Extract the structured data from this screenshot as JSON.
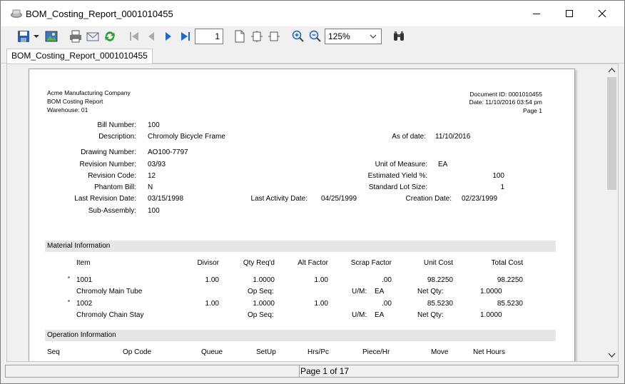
{
  "window": {
    "title": "BOM_Costing_Report_0001010455"
  },
  "toolbar": {
    "page_value": "1",
    "zoom_value": "125%"
  },
  "tabs": [
    {
      "label": "BOM_Costing_Report_0001010455"
    }
  ],
  "report": {
    "company": "Acme Manufacturing Company",
    "report_name": "BOM Costing Report",
    "warehouse": "Warehouse: 01",
    "document_id": "Document ID: 0001010455",
    "date": "Date: 11/10/2016 03:54 pm",
    "page": "Page 1",
    "labels": {
      "bill_number": "Bill Number:",
      "description": "Description:",
      "as_of_date": "As of date:",
      "drawing_number": "Drawing Number:",
      "revision_number": "Revision Number:",
      "revision_code": "Revision Code:",
      "phantom_bill": "Phantom Bill:",
      "last_revision_date": "Last Revision Date:",
      "sub_assembly": "Sub-Assembly:",
      "unit_of_measure": "Unit of Measure:",
      "estimated_yield": "Estimated Yield %:",
      "standard_lot_size": "Standard Lot Size:",
      "last_activity_date": "Last Activity Date:",
      "creation_date": "Creation Date:"
    },
    "values": {
      "bill_number": "100",
      "description": "Chromoly Bicycle Frame",
      "as_of_date": "11/10/2016",
      "drawing_number": "AO100-7797",
      "revision_number": "03/93",
      "revision_code": "12",
      "phantom_bill": "N",
      "last_revision_date": "03/15/1998",
      "sub_assembly": "100",
      "unit_of_measure": "EA",
      "estimated_yield": "100",
      "standard_lot_size": "1",
      "last_activity_date": "04/25/1999",
      "creation_date": "02/23/1999"
    },
    "material_section": "Material Information",
    "material_headers": {
      "item": "Item",
      "divisor": "Divisor",
      "qty_reqd": "Qty Req'd",
      "alt_factor": "Alt Factor",
      "scrap_factor": "Scrap Factor",
      "unit_cost": "Unit Cost",
      "total_cost": "Total Cost"
    },
    "materials": [
      {
        "star": "*",
        "item": "1001",
        "divisor": "1.00",
        "qty": "1.0000",
        "alt": "1.00",
        "scrap": ".00",
        "unit_cost": "98.2250",
        "total_cost": "98.2250",
        "desc": "Chromoly Main Tube",
        "op_seq_label": "Op Seq:",
        "um_label": "U/M:",
        "um": "EA",
        "net_qty_label": "Net Qty:",
        "net_qty": "1.0000"
      },
      {
        "star": "*",
        "item": "1002",
        "divisor": "1.00",
        "qty": "1.0000",
        "alt": "1.00",
        "scrap": ".00",
        "unit_cost": "85.5230",
        "total_cost": "85.5230",
        "desc": "Chromoly Chain Stay",
        "op_seq_label": "Op Seq:",
        "um_label": "U/M:",
        "um": "EA",
        "net_qty_label": "Net Qty:",
        "net_qty": "1.0000"
      }
    ],
    "operation_section": "Operation Information",
    "operation_headers": {
      "seq": "Seq",
      "op_code": "Op Code",
      "queue": "Queue",
      "setup": "SetUp",
      "hrs_pc": "Hrs/Pc",
      "piece_hr": "Piece/Hr",
      "move": "Move",
      "net_hours": "Net Hours"
    }
  },
  "status": {
    "page_text": "Page 1 of 17"
  }
}
